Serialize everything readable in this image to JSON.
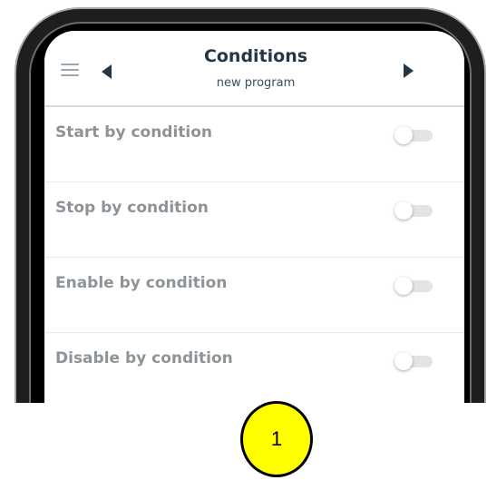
{
  "header": {
    "title": "Conditions",
    "subtitle": "new program"
  },
  "icons": {
    "menu": "hamburger-menu-icon",
    "prev": "triangle-left-icon",
    "next": "triangle-right-icon"
  },
  "rows": [
    {
      "label": "Start by condition",
      "enabled": false
    },
    {
      "label": "Stop by condition",
      "enabled": false
    },
    {
      "label": "Enable by condition",
      "enabled": false
    },
    {
      "label": "Disable by condition",
      "enabled": false
    }
  ],
  "callout": {
    "label": "1",
    "color": "#ffff00"
  },
  "colors": {
    "title": "#243746",
    "row_label": "#8d9397",
    "toggle_track": "#e2e4e6",
    "bezel": "#1e1e1e"
  }
}
